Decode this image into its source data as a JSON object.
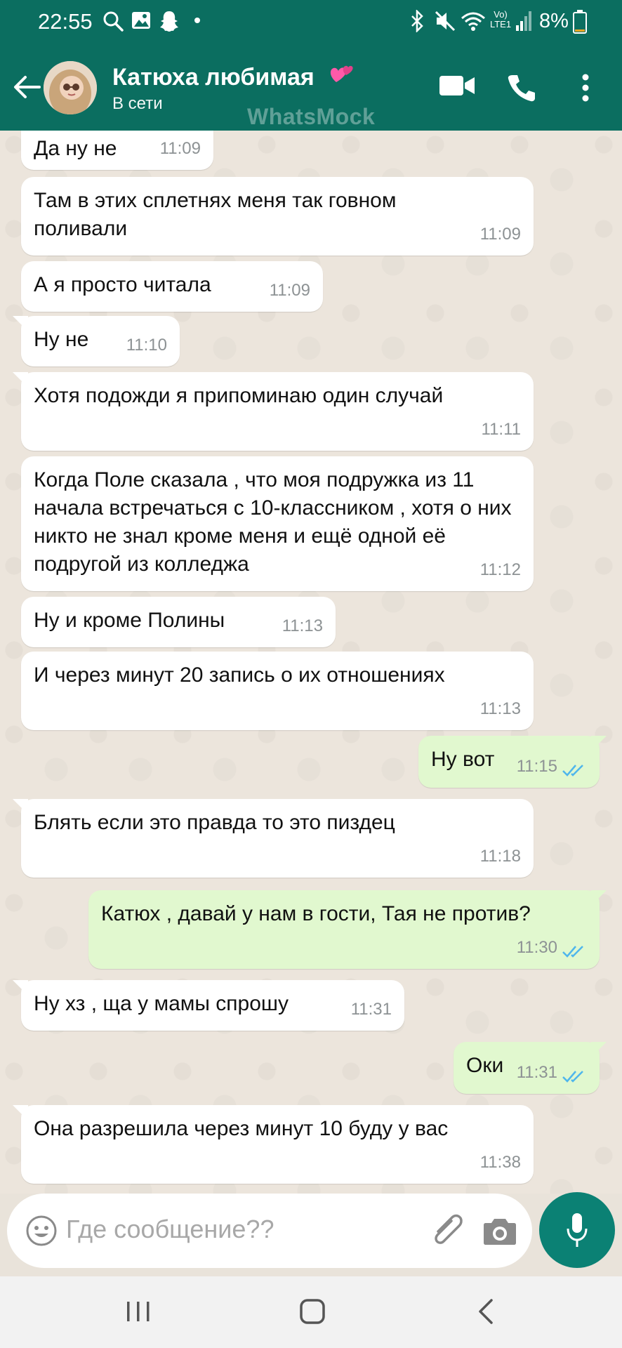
{
  "status_bar": {
    "time": "22:55",
    "battery": "8%",
    "network": "Vo) LTE1"
  },
  "header": {
    "contact_name": "Катюха любимая",
    "status": "В сети",
    "watermark": "WhatsMock"
  },
  "messages": [
    {
      "dir": "in",
      "text": "Да ну не",
      "time": "11:09"
    },
    {
      "dir": "in",
      "text": "Там в этих сплетнях меня так говном поливали",
      "time": "11:09"
    },
    {
      "dir": "in",
      "text": "А я просто читала",
      "time": "11:09"
    },
    {
      "dir": "in",
      "text": "Ну не",
      "time": "11:10"
    },
    {
      "dir": "in",
      "text": "Хотя подожди я припоминаю один случай",
      "time": "11:11"
    },
    {
      "dir": "in",
      "text": "Когда Поле сказала , что моя подружка из 11 начала встречаться с 10-классником , хотя о них никто не знал кроме меня и ещё одной её подругой из колледжа",
      "time": "11:12"
    },
    {
      "dir": "in",
      "text": "Ну и кроме Полины",
      "time": "11:13"
    },
    {
      "dir": "in",
      "text": "И через минут 20 запись о их отношениях",
      "time": "11:13"
    },
    {
      "dir": "out",
      "text": "Ну вот",
      "time": "11:15"
    },
    {
      "dir": "in",
      "text": "Блять если это правда то это пиздец",
      "time": "11:18"
    },
    {
      "dir": "out",
      "text": "Катюх , давай у нам в гости,  Тая не против?",
      "time": "11:30"
    },
    {
      "dir": "in",
      "text": "Ну хз , ща у мамы спрошу",
      "time": "11:31"
    },
    {
      "dir": "out",
      "text": "Оки",
      "time": "11:31"
    },
    {
      "dir": "in",
      "text": "Она разрешила через минут 10 буду у вас",
      "time": "11:38"
    }
  ],
  "input": {
    "placeholder": "Где сообщение??"
  },
  "colors": {
    "header": "#0b6e60",
    "outgoing": "#e1f8cf",
    "incoming": "#ffffff",
    "tick": "#4fb6ec",
    "mic": "#0b8174"
  }
}
